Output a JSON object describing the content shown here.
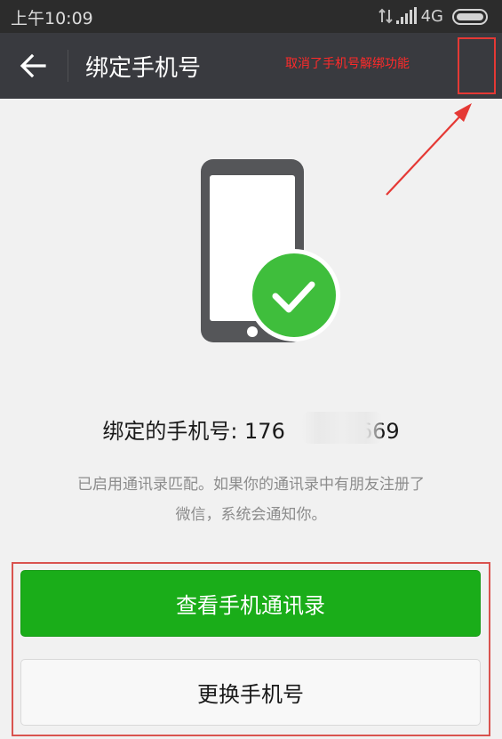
{
  "status_bar": {
    "time": "上午10:09",
    "network_label": "4G"
  },
  "title_bar": {
    "title": "绑定手机号"
  },
  "annotation": {
    "note": "取消了手机号解绑功能",
    "color": "#ff2a2a"
  },
  "phone_info": {
    "label": "绑定的手机号: 176",
    "number_suffix": "669"
  },
  "notice": {
    "line1": "已启用通讯录匹配。如果你的通讯录中有朋友注册了",
    "line2": "微信，系统会通知你。"
  },
  "buttons": {
    "view_contacts_label": "查看手机通讯录",
    "change_number_label": "更换手机号"
  },
  "colors": {
    "accent_green": "#1aad19",
    "title_bar": "#393a3f",
    "status_bar": "#2c2c2c"
  }
}
